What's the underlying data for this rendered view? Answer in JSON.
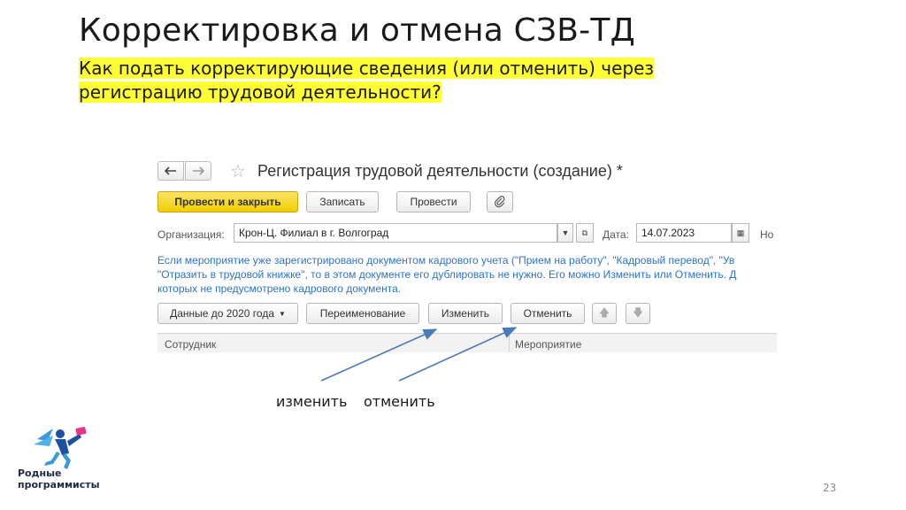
{
  "slide": {
    "title": "Корректировка и отмена СЗВ-ТД",
    "subtitle_line1": "Как подать корректирующие сведения (или отменить) через",
    "subtitle_line2": "регистрацию трудовой деятельности?",
    "highlight_color": "#ffff33",
    "page_number": "23"
  },
  "window": {
    "back_icon": "arrow-left-icon",
    "forward_icon": "arrow-right-icon",
    "favorite_icon": "star-icon",
    "title": "Регистрация трудовой деятельности (создание) *"
  },
  "toolbar": {
    "post_close_label": "Провести и закрыть",
    "write_label": "Записать",
    "post_label": "Провести",
    "attach_icon": "paperclip-icon",
    "primary_color": "#f2cd00"
  },
  "form": {
    "org_label": "Организация:",
    "org_value": "Крон-Ц. Филиал в г. Волгоград",
    "date_label": "Дата:",
    "date_value": "14.07.2023",
    "number_label": "Но"
  },
  "info": {
    "line1": "Если мероприятие уже зарегистрировано документом кадрового учета (\"Прием на работу\", \"Кадровый перевод\", \"Ув",
    "line2": "\"Отразить в трудовой книжке\", то в этом документе его дублировать не нужно. Его можно Изменить или Отменить. Д",
    "line3": "которых не предусмотрено кадрового документа.",
    "color": "#2e73c9"
  },
  "actions": {
    "data_before_2020_label": "Данные до 2020 года",
    "rename_label": "Переименование",
    "change_label": "Изменить",
    "cancel_label": "Отменить",
    "up_icon": "arrow-up-icon",
    "down_icon": "arrow-down-icon"
  },
  "table": {
    "columns": [
      "Сотрудник",
      "Мероприятие"
    ]
  },
  "annotations": {
    "change_caption": "изменить",
    "cancel_caption": "отменить",
    "arrow_color": "#4a7ab8"
  },
  "logo": {
    "line1": "Родные",
    "line2": "программисты"
  }
}
